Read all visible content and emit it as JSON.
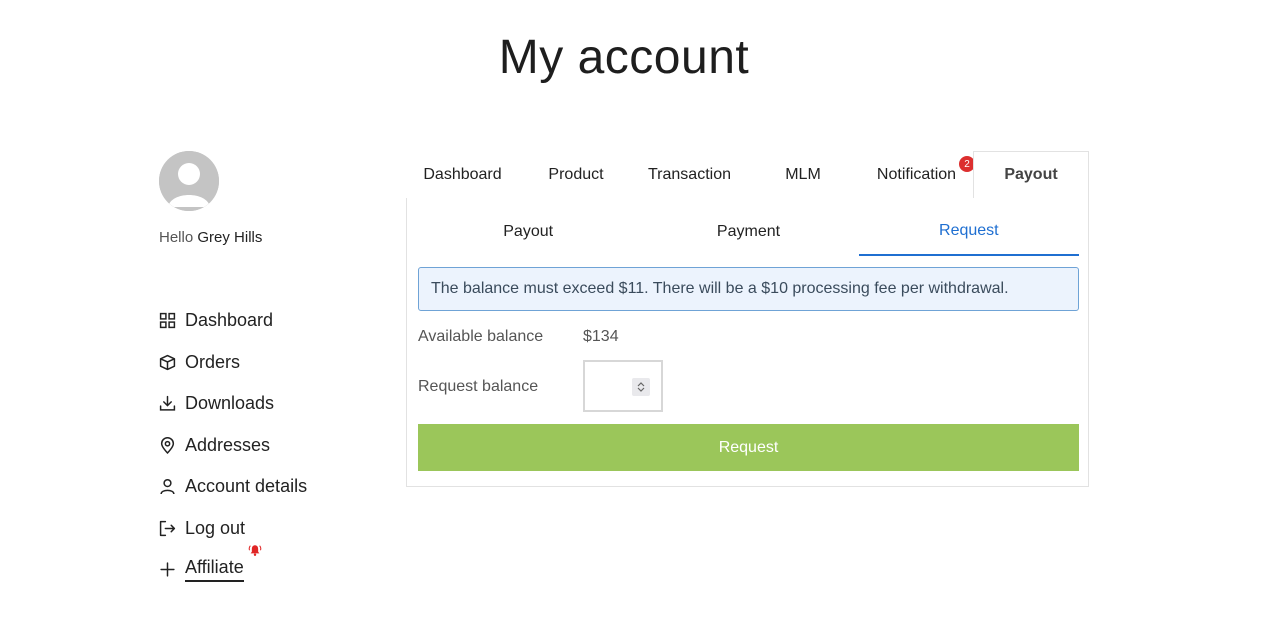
{
  "page": {
    "title": "My account"
  },
  "user": {
    "greeting": "Hello",
    "name": "Grey Hills"
  },
  "sidebar": {
    "items": [
      {
        "label": "Dashboard",
        "icon": "grid-icon"
      },
      {
        "label": "Orders",
        "icon": "box-icon"
      },
      {
        "label": "Downloads",
        "icon": "download-icon"
      },
      {
        "label": "Addresses",
        "icon": "map-pin-icon"
      },
      {
        "label": "Account details",
        "icon": "user-icon"
      },
      {
        "label": "Log out",
        "icon": "logout-icon"
      },
      {
        "label": "Affiliate",
        "icon": "plus-icon"
      }
    ]
  },
  "tabs": [
    {
      "label": "Dashboard"
    },
    {
      "label": "Product"
    },
    {
      "label": "Transaction"
    },
    {
      "label": "MLM"
    },
    {
      "label": "Notification",
      "badge": "2"
    },
    {
      "label": "Payout",
      "active": true
    }
  ],
  "subtabs": [
    {
      "label": "Payout"
    },
    {
      "label": "Payment"
    },
    {
      "label": "Request",
      "active": true
    }
  ],
  "notice": "The balance must exceed $11. There will be a $10 processing fee per withdrawal.",
  "form": {
    "available_label": "Available balance",
    "available_value": "$134",
    "request_label": "Request balance",
    "request_value": "",
    "submit_label": "Request"
  },
  "colors": {
    "accent": "#1f6fd1",
    "submit": "#9bc65a",
    "badge": "#dc2f2f",
    "alert_bg": "#ecf3fd"
  }
}
